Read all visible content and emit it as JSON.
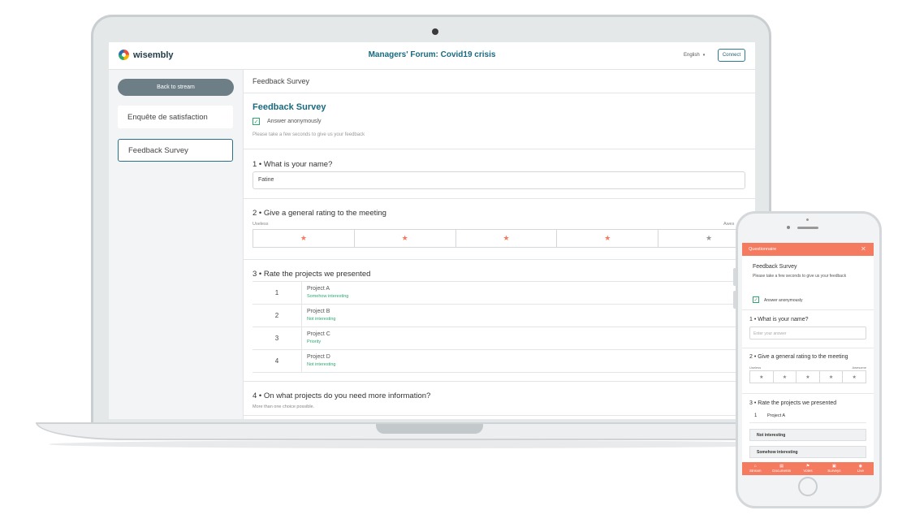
{
  "app": {
    "logo_text": "wisembly",
    "event_title": "Managers' Forum: Covid19 crisis",
    "language": "English",
    "connect_label": "Connect"
  },
  "sidebar": {
    "back_label": "Back to stream",
    "items": [
      {
        "label": "Enquête de satisfaction",
        "active": false
      },
      {
        "label": "Feedback Survey",
        "active": true
      }
    ]
  },
  "survey": {
    "breadcrumb": "Feedback Survey",
    "title": "Feedback Survey",
    "anonymous_label": "Answer anonymously",
    "anonymous_checked": true,
    "hint": "Please take a few seconds to give us your feedback",
    "q1": {
      "label": "1 •  What is your name?",
      "value": "Fatine"
    },
    "q2": {
      "label": "2 •  Give a general rating to the meeting",
      "scale_min": "Useless",
      "scale_max": "Awes",
      "stars": 5,
      "selected": 4,
      "star_color_selected": "#f47a60",
      "star_color_empty": "#999999"
    },
    "q3": {
      "label": "3 •  Rate the projects we presented",
      "rows": [
        {
          "rank": "1",
          "name": "Project A",
          "status": "Somehow interesting"
        },
        {
          "rank": "2",
          "name": "Project B",
          "status": "Not interesting"
        },
        {
          "rank": "3",
          "name": "Project C",
          "status": "Priority"
        },
        {
          "rank": "4",
          "name": "Project D",
          "status": "Not interesting"
        }
      ]
    },
    "q4": {
      "label": "4 •  On what projects do you need more information?",
      "sub": "More than one choice possible."
    }
  },
  "phone": {
    "header_title": "Questionnaire",
    "close_icon": "close-icon",
    "survey_title": "Feedback Survey",
    "hint": "Please take a few seconds to give us your feedback",
    "anonymous_label": "Answer anonymously",
    "q1_label": "1 •  What is your name?",
    "q1_placeholder": "Enter your answer",
    "q2_label": "2 •  Give a general rating to the meeting",
    "scale_min": "Useless",
    "scale_max": "Awesome",
    "q3_label": "3 •  Rate the projects we presented",
    "rank_num": "1",
    "rank_name": "Project A",
    "options": [
      "Not interesting",
      "Somehow interesting"
    ],
    "tabs": [
      {
        "label": "Stream",
        "icon": "home-icon"
      },
      {
        "label": "Documents",
        "icon": "document-icon"
      },
      {
        "label": "Votes",
        "icon": "vote-icon"
      },
      {
        "label": "Surveys",
        "icon": "survey-icon"
      },
      {
        "label": "Live",
        "icon": "chat-icon"
      }
    ],
    "accent_color": "#f47a60"
  }
}
